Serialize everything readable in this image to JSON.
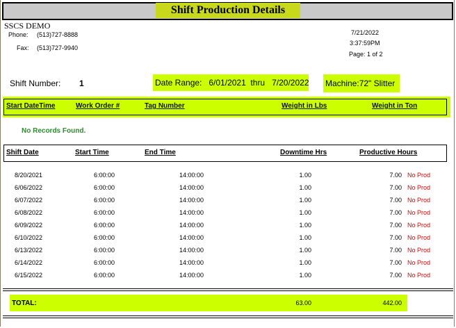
{
  "report": {
    "title": "Shift Production Details",
    "company": "SSCS DEMO",
    "phone_label": "Phone:",
    "phone": "(513)727-8888",
    "fax_label": "Fax:",
    "fax": "(513)727-9940",
    "date": "7/21/2022",
    "time": "3:37:59PM",
    "page": "Page: 1 of 2"
  },
  "filters": {
    "shift_label": "Shift Number:",
    "shift_value": "1",
    "date_range": "Date Range:   6/01/2021  thru   7/20/2022",
    "machine": "Machine:72\" Slitter"
  },
  "production_table": {
    "headers": [
      "Start DateTime",
      "Work Order #",
      "Tag Number",
      "Weight in Lbs",
      "Weight in Ton"
    ],
    "empty_message": "No Records Found."
  },
  "shift_table": {
    "headers": [
      "Shift Date",
      "Start Time",
      "End Time",
      "Downtime Hrs",
      "Productive Hours"
    ],
    "rows": [
      {
        "date": "8/20/2021",
        "start": "6:00:00",
        "end": "14:00:00",
        "downtime": "1.00",
        "productive": "7.00",
        "status": "No Prod"
      },
      {
        "date": "6/06/2022",
        "start": "6:00:00",
        "end": "14:00:00",
        "downtime": "1.00",
        "productive": "7.00",
        "status": "No Prod"
      },
      {
        "date": "6/07/2022",
        "start": "6:00:00",
        "end": "14:00:00",
        "downtime": "1.00",
        "productive": "7.00",
        "status": "No Prod"
      },
      {
        "date": "6/08/2022",
        "start": "6:00:00",
        "end": "14:00:00",
        "downtime": "1.00",
        "productive": "7.00",
        "status": "No Prod"
      },
      {
        "date": "6/09/2022",
        "start": "6:00:00",
        "end": "14:00:00",
        "downtime": "1.00",
        "productive": "7.00",
        "status": "No Prod"
      },
      {
        "date": "6/10/2022",
        "start": "6:00:00",
        "end": "14:00:00",
        "downtime": "1.00",
        "productive": "7.00",
        "status": "No Prod"
      },
      {
        "date": "6/13/2022",
        "start": "6:00:00",
        "end": "14:00:00",
        "downtime": "1.00",
        "productive": "7.00",
        "status": "No Prod"
      },
      {
        "date": "6/14/2022",
        "start": "6:00:00",
        "end": "14:00:00",
        "downtime": "1.00",
        "productive": "7.00",
        "status": "No Prod"
      },
      {
        "date": "6/15/2022",
        "start": "6:00:00",
        "end": "14:00:00",
        "downtime": "1.00",
        "productive": "7.00",
        "status": "No Prod"
      }
    ]
  },
  "totals": {
    "label": "TOTAL:",
    "downtime": "63.00",
    "productive": "442.00"
  },
  "colors": {
    "highlight": "#ccff00",
    "title_highlight": "#c8d81a",
    "no_records": "#2e8b2e",
    "no_prod": "#e00000"
  }
}
